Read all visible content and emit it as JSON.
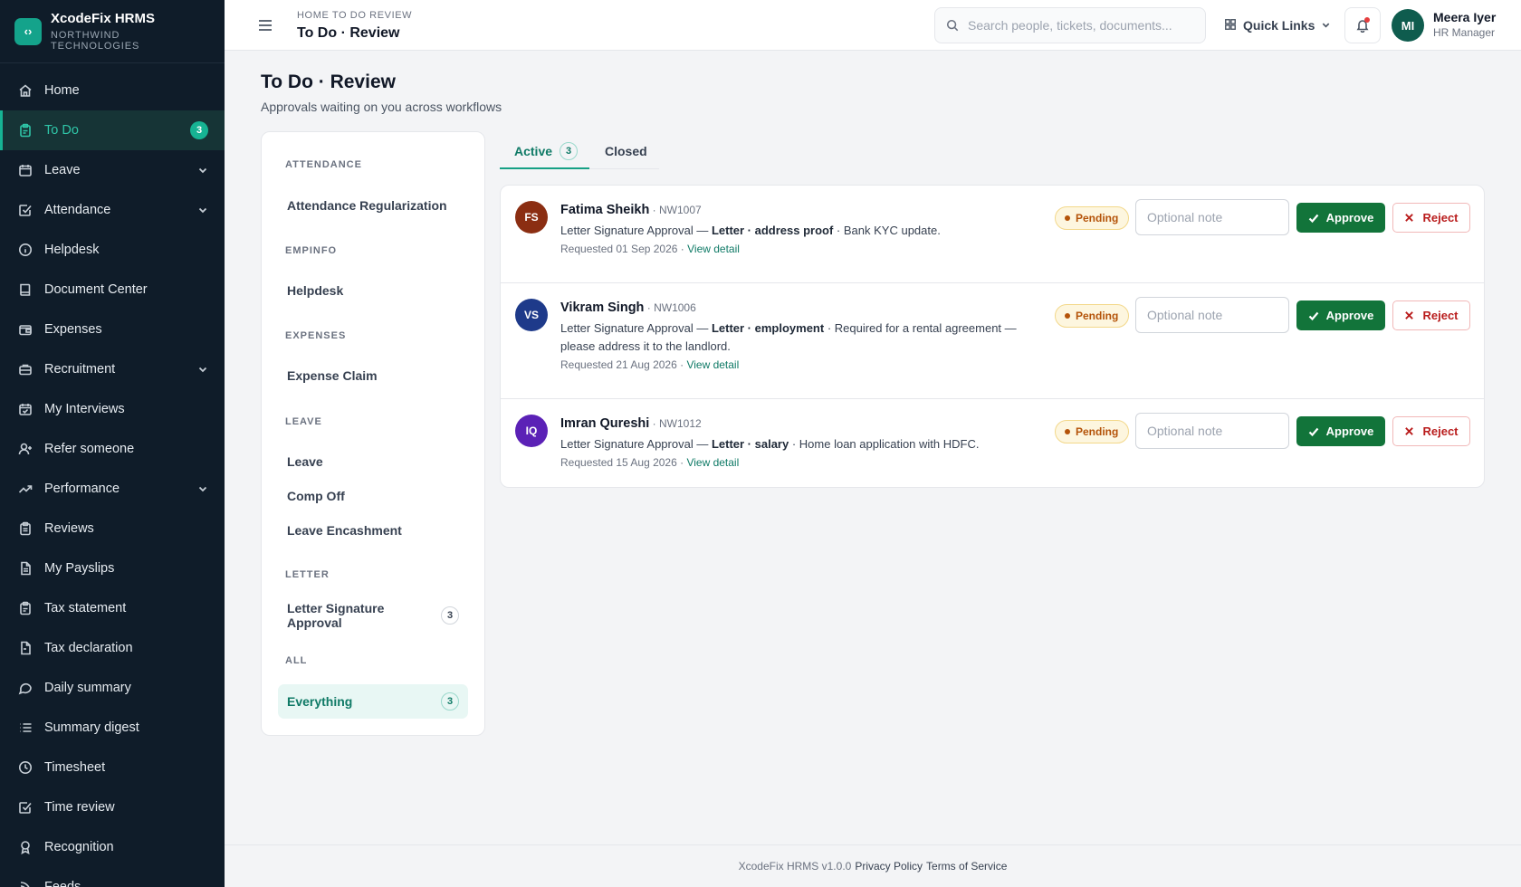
{
  "brand": {
    "name": "XcodeFix HRMS",
    "org": "NORTHWIND TECHNOLOGIES",
    "logo_glyph": "‹›"
  },
  "sidebar": {
    "items": [
      {
        "label": "Home",
        "icon": "home-icon"
      },
      {
        "label": "To Do",
        "icon": "clipboard-icon",
        "badge": "3",
        "active": true
      },
      {
        "label": "Leave",
        "icon": "calendar-icon",
        "expandable": true
      },
      {
        "label": "Attendance",
        "icon": "check-square-icon",
        "expandable": true
      },
      {
        "label": "Helpdesk",
        "icon": "info-icon"
      },
      {
        "label": "Document Center",
        "icon": "book-icon"
      },
      {
        "label": "Expenses",
        "icon": "wallet-icon"
      },
      {
        "label": "Recruitment",
        "icon": "briefcase-icon",
        "expandable": true
      },
      {
        "label": "My Interviews",
        "icon": "calendar-check-icon"
      },
      {
        "label": "Refer someone",
        "icon": "user-plus-icon"
      },
      {
        "label": "Performance",
        "icon": "trending-up-icon",
        "expandable": true
      },
      {
        "label": "Reviews",
        "icon": "clipboard-list-icon"
      },
      {
        "label": "My Payslips",
        "icon": "file-text-icon"
      },
      {
        "label": "Tax statement",
        "icon": "clipboard-icon"
      },
      {
        "label": "Tax declaration",
        "icon": "file-icon"
      },
      {
        "label": "Daily summary",
        "icon": "message-circle-icon"
      },
      {
        "label": "Summary digest",
        "icon": "list-icon"
      },
      {
        "label": "Timesheet",
        "icon": "clock-icon"
      },
      {
        "label": "Time review",
        "icon": "check-square-icon"
      },
      {
        "label": "Recognition",
        "icon": "award-icon"
      },
      {
        "label": "Feeds",
        "icon": "rss-icon"
      }
    ]
  },
  "header": {
    "breadcrumb": "HOME  TO DO REVIEW",
    "title": "To Do · Review",
    "search_placeholder": "Search people, tickets, documents...",
    "quick_links_label": "Quick Links",
    "user": {
      "initials": "MI",
      "name": "Meera Iyer",
      "role": "HR Manager"
    }
  },
  "page": {
    "title": "To Do · Review",
    "subtitle": "Approvals waiting on you across workflows"
  },
  "categories": [
    {
      "group": "ATTENDANCE",
      "items": [
        {
          "label": "Attendance Regularization"
        }
      ]
    },
    {
      "group": "EMPINFO",
      "items": [
        {
          "label": "Helpdesk"
        }
      ]
    },
    {
      "group": "EXPENSES",
      "items": [
        {
          "label": "Expense Claim"
        }
      ]
    },
    {
      "group": "LEAVE",
      "items": [
        {
          "label": "Leave"
        },
        {
          "label": "Comp Off"
        },
        {
          "label": "Leave Encashment"
        }
      ]
    },
    {
      "group": "LETTER",
      "items": [
        {
          "label": "Letter Signature Approval",
          "count": "3"
        }
      ]
    },
    {
      "group": "ALL",
      "items": [
        {
          "label": "Everything",
          "count": "3",
          "active": true
        }
      ]
    }
  ],
  "tabs": [
    {
      "label": "Active",
      "count": "3",
      "active": true
    },
    {
      "label": "Closed"
    }
  ],
  "requests": [
    {
      "initials": "FS",
      "avatar_color": "#8b2e12",
      "name": "Fatima Sheikh",
      "emp_id": "NW1007",
      "type": "Letter Signature Approval",
      "category": "Letter · address proof",
      "reason": "Bank KYC update.",
      "requested": "Requested 01 Sep 2026",
      "view_label": "View detail",
      "status": "Pending"
    },
    {
      "initials": "VS",
      "avatar_color": "#1e3a8a",
      "name": "Vikram Singh",
      "emp_id": "NW1006",
      "type": "Letter Signature Approval",
      "category": "Letter · employment",
      "reason": "Required for a rental agreement — please address it to the landlord.",
      "requested": "Requested 21 Aug 2026",
      "view_label": "View detail",
      "status": "Pending"
    },
    {
      "initials": "IQ",
      "avatar_color": "#5b21b6",
      "name": "Imran Qureshi",
      "emp_id": "NW1012",
      "type": "Letter Signature Approval",
      "category": "Letter · salary",
      "reason": "Home loan application with HDFC.",
      "requested": "Requested 15 Aug 2026",
      "view_label": "View detail",
      "status": "Pending"
    }
  ],
  "actions": {
    "note_placeholder": "Optional note",
    "approve_label": "Approve",
    "reject_label": "Reject"
  },
  "footer": {
    "version": "XcodeFix HRMS v1.0.0",
    "privacy": "Privacy Policy",
    "terms": "Terms of Service"
  }
}
